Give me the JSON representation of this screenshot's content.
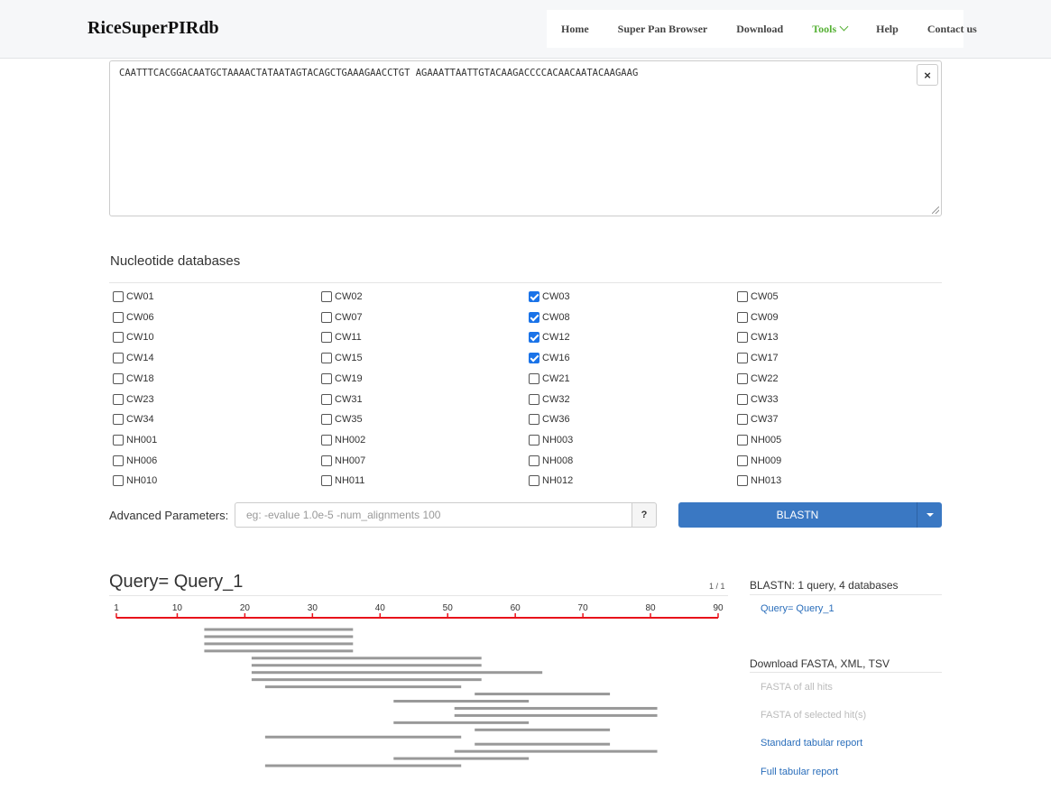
{
  "header": {
    "logo": "RiceSuperPIRdb",
    "nav": [
      "Home",
      "Super Pan Browser",
      "Download",
      "Tools",
      "Help",
      "Contact us"
    ],
    "active_nav": "Tools"
  },
  "sequence": {
    "text": "CAATTTCACGGACAATGCTAAAACTATAATAGTACAGCTGAAAGAACCTGT AGAAATTAATTGTACAAGACCCCACAACAATACAAGAAG",
    "clear_label": "×"
  },
  "databases": {
    "title": "Nucleotide databases",
    "items": [
      {
        "name": "CW01",
        "checked": false
      },
      {
        "name": "CW02",
        "checked": false
      },
      {
        "name": "CW03",
        "checked": true
      },
      {
        "name": "CW05",
        "checked": false
      },
      {
        "name": "CW06",
        "checked": false
      },
      {
        "name": "CW07",
        "checked": false
      },
      {
        "name": "CW08",
        "checked": true
      },
      {
        "name": "CW09",
        "checked": false
      },
      {
        "name": "CW10",
        "checked": false
      },
      {
        "name": "CW11",
        "checked": false
      },
      {
        "name": "CW12",
        "checked": true
      },
      {
        "name": "CW13",
        "checked": false
      },
      {
        "name": "CW14",
        "checked": false
      },
      {
        "name": "CW15",
        "checked": false
      },
      {
        "name": "CW16",
        "checked": true
      },
      {
        "name": "CW17",
        "checked": false
      },
      {
        "name": "CW18",
        "checked": false
      },
      {
        "name": "CW19",
        "checked": false
      },
      {
        "name": "CW21",
        "checked": false
      },
      {
        "name": "CW22",
        "checked": false
      },
      {
        "name": "CW23",
        "checked": false
      },
      {
        "name": "CW31",
        "checked": false
      },
      {
        "name": "CW32",
        "checked": false
      },
      {
        "name": "CW33",
        "checked": false
      },
      {
        "name": "CW34",
        "checked": false
      },
      {
        "name": "CW35",
        "checked": false
      },
      {
        "name": "CW36",
        "checked": false
      },
      {
        "name": "CW37",
        "checked": false
      },
      {
        "name": "NH001",
        "checked": false
      },
      {
        "name": "NH002",
        "checked": false
      },
      {
        "name": "NH003",
        "checked": false
      },
      {
        "name": "NH005",
        "checked": false
      },
      {
        "name": "NH006",
        "checked": false
      },
      {
        "name": "NH007",
        "checked": false
      },
      {
        "name": "NH008",
        "checked": false
      },
      {
        "name": "NH009",
        "checked": false
      },
      {
        "name": "NH010",
        "checked": false
      },
      {
        "name": "NH011",
        "checked": false
      },
      {
        "name": "NH012",
        "checked": false
      },
      {
        "name": "NH013",
        "checked": false
      }
    ]
  },
  "advanced": {
    "label": "Advanced Parameters:",
    "placeholder": "eg: -evalue 1.0e-5 -num_alignments 100",
    "value": "",
    "help_label": "?",
    "submit_label": "BLASTN"
  },
  "results": {
    "query_title": "Query= Query_1",
    "page_count": "1 / 1",
    "axis": {
      "min": 1,
      "max": 90,
      "ticks": [
        1,
        10,
        20,
        30,
        40,
        50,
        60,
        70,
        80,
        90
      ],
      "color": "#e8121b"
    },
    "hits": [
      {
        "start": 14,
        "end": 36
      },
      {
        "start": 14,
        "end": 36
      },
      {
        "start": 14,
        "end": 36
      },
      {
        "start": 14,
        "end": 36
      },
      {
        "start": 21,
        "end": 55
      },
      {
        "start": 21,
        "end": 55
      },
      {
        "start": 21,
        "end": 64
      },
      {
        "start": 21,
        "end": 55
      },
      {
        "start": 23,
        "end": 52
      },
      {
        "start": 54,
        "end": 74
      },
      {
        "start": 42,
        "end": 62
      },
      {
        "start": 51,
        "end": 81
      },
      {
        "start": 51,
        "end": 81
      },
      {
        "start": 42,
        "end": 62
      },
      {
        "start": 54,
        "end": 74
      },
      {
        "start": 23,
        "end": 52
      },
      {
        "start": 54,
        "end": 74
      },
      {
        "start": 51,
        "end": 81
      },
      {
        "start": 42,
        "end": 62
      },
      {
        "start": 23,
        "end": 52
      }
    ],
    "hit_color": "#999999"
  },
  "side": {
    "summary_title": "BLASTN: 1 query, 4 databases",
    "query_link": "Query= Query_1",
    "download_title": "Download FASTA, XML, TSV",
    "downloads": [
      {
        "label": "FASTA of all hits",
        "enabled": false
      },
      {
        "label": "FASTA of selected hit(s)",
        "enabled": false
      },
      {
        "label": "Standard tabular report",
        "enabled": true
      },
      {
        "label": "Full tabular report",
        "enabled": true
      }
    ]
  }
}
